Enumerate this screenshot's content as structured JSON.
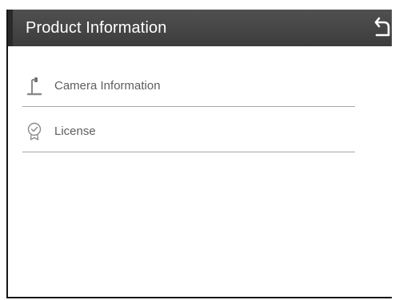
{
  "header": {
    "title": "Product Information",
    "back_icon": "back-arrow-icon"
  },
  "menu": {
    "items": [
      {
        "label": "Camera Information",
        "icon": "camera-stand-icon"
      },
      {
        "label": "License",
        "icon": "license-badge-icon"
      }
    ]
  },
  "colors": {
    "header_bg": "#454545",
    "header_text": "#ffffff",
    "item_text": "#5e5e5e",
    "divider": "#a8a8a8"
  }
}
